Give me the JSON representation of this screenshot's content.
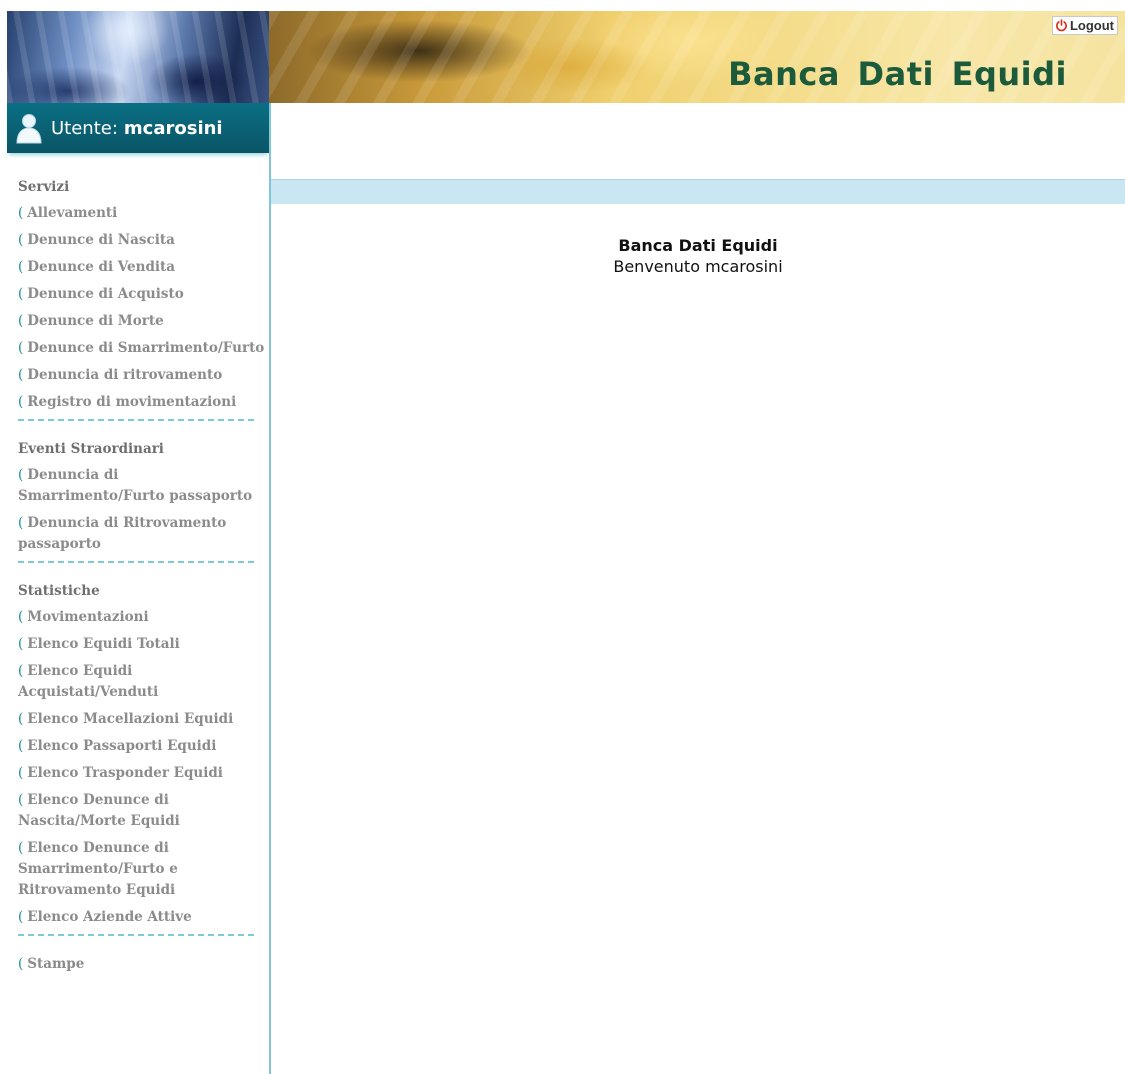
{
  "header": {
    "site_title": "Banca Dati Equidi",
    "logout_label": "Logout"
  },
  "user": {
    "label": "Utente:",
    "name": "mcarosini"
  },
  "sidebar": {
    "sections": [
      {
        "title": "Servizi",
        "items": [
          "Allevamenti",
          "Denunce di Nascita",
          "Denunce di Vendita",
          "Denunce di Acquisto",
          "Denunce di Morte",
          "Denunce di Smarrimento/Furto",
          "Denuncia di ritrovamento",
          "Registro di movimentazioni"
        ]
      },
      {
        "title": "Eventi Straordinari",
        "items": [
          "Denuncia di Smarrimento/Furto passaporto",
          "Denuncia di Ritrovamento passaporto"
        ]
      },
      {
        "title": "Statistiche",
        "items": [
          "Movimentazioni",
          "Elenco Equidi Totali",
          "Elenco Equidi Acquistati/Venduti",
          "Elenco Macellazioni Equidi",
          "Elenco Passaporti Equidi",
          "Elenco Trasponder Equidi",
          "Elenco Denunce di Nascita/Morte Equidi",
          "Elenco Denunce di Smarrimento/Furto e Ritrovamento Equidi",
          "Elenco Aziende Attive"
        ]
      },
      {
        "title": "",
        "items": [
          "Stampe"
        ]
      }
    ]
  },
  "main": {
    "title": "Banca Dati Equidi",
    "welcome": "Benvenuto mcarosini"
  },
  "colors": {
    "accent": "#0b6478",
    "title_green": "#1c5a3c",
    "menu_text": "#8b8b8b",
    "bar_blue": "#c9e6f2"
  }
}
